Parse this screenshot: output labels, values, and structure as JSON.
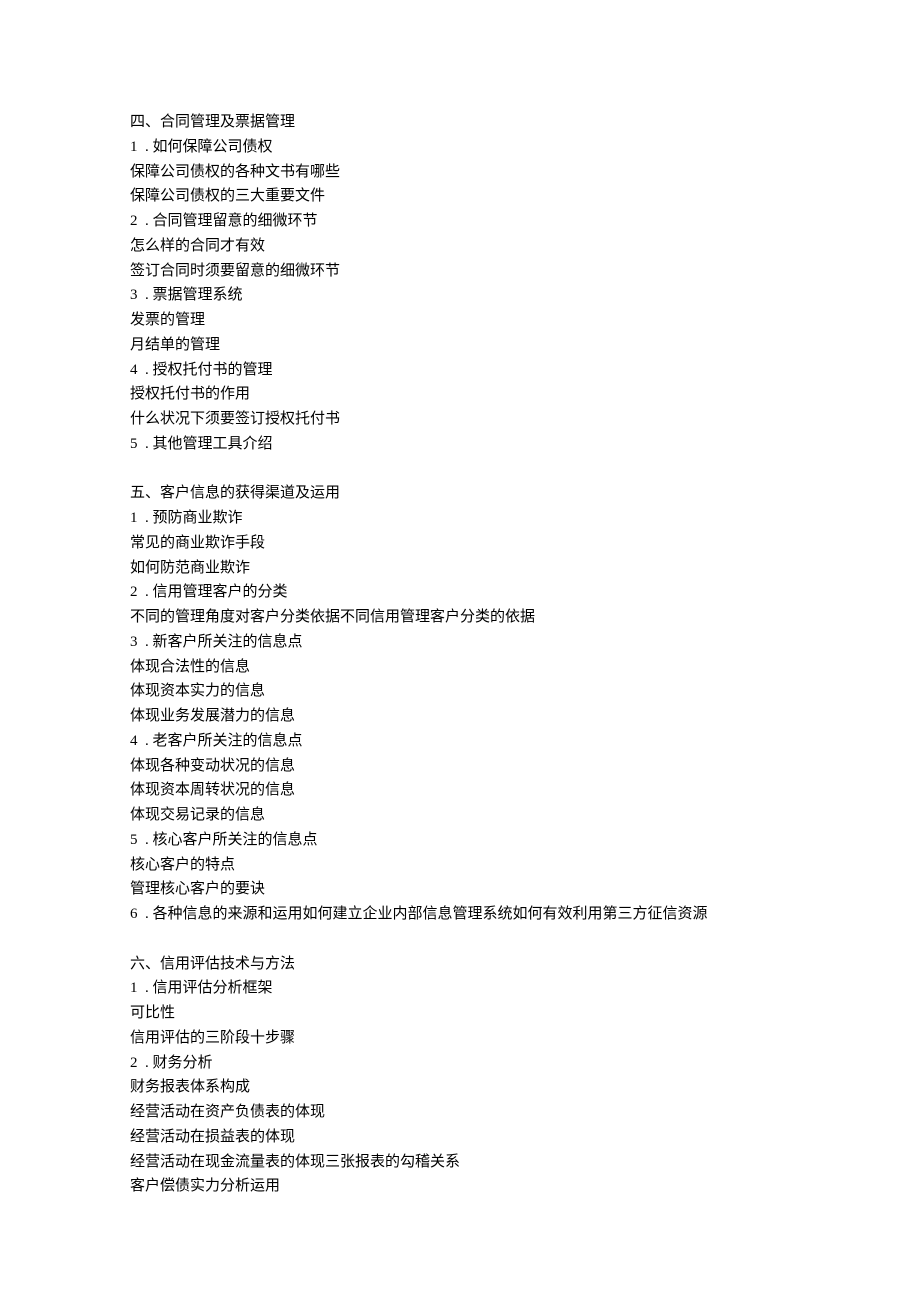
{
  "lines": [
    "四、合同管理及票据管理",
    "1  . 如何保障公司债权",
    "保障公司债权的各种文书有哪些",
    "保障公司债权的三大重要文件",
    "2  . 合同管理留意的细微环节",
    "怎么样的合同才有效",
    "签订合同时须要留意的细微环节",
    "3  . 票据管理系统",
    "发票的管理",
    "月结单的管理",
    "4  . 授权托付书的管理",
    "授权托付书的作用",
    "什么状况下须要签订授权托付书",
    "5  . 其他管理工具介绍",
    "",
    "五、客户信息的获得渠道及运用",
    "1  . 预防商业欺诈",
    "常见的商业欺诈手段",
    "如何防范商业欺诈",
    "2  . 信用管理客户的分类",
    "不同的管理角度对客户分类依据不同信用管理客户分类的依据",
    "3  . 新客户所关注的信息点",
    "体现合法性的信息",
    "体现资本实力的信息",
    "体现业务发展潜力的信息",
    "4  . 老客户所关注的信息点",
    "体现各种变动状况的信息",
    "体现资本周转状况的信息",
    "体现交易记录的信息",
    "5  . 核心客户所关注的信息点",
    "核心客户的特点",
    "管理核心客户的要诀",
    "6  . 各种信息的来源和运用如何建立企业内部信息管理系统如何有效利用第三方征信资源",
    "",
    "六、信用评估技术与方法",
    "1  . 信用评估分析框架",
    "可比性",
    "信用评估的三阶段十步骤",
    "2  . 财务分析",
    "财务报表体系构成",
    "经营活动在资产负债表的体现",
    "经营活动在损益表的体现",
    "经营活动在现金流量表的体现三张报表的勾稽关系",
    "客户偿债实力分析运用"
  ]
}
